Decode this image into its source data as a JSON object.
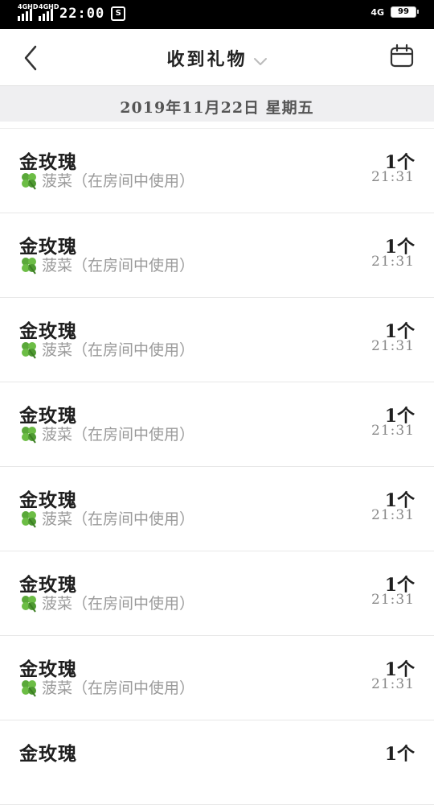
{
  "status_bar": {
    "network1": "4GHD",
    "network2": "4GHD",
    "time": "22:00",
    "right_network": "4G",
    "battery": "99"
  },
  "nav": {
    "title": "收到礼物"
  },
  "date_header": "2019年11月22日 星期五",
  "icons": {
    "back": "chevron-left-icon",
    "dropdown": "chevron-down-icon",
    "calendar": "calendar-icon",
    "clover": "four-leaf-clover-icon"
  },
  "colors": {
    "header_bg": "#efeff1",
    "clover_green": "#5aa83a"
  },
  "gifts": [
    {
      "name": "金玫瑰",
      "sender": "菠菜（在房间中使用）",
      "count": "1个",
      "time": "21:31"
    },
    {
      "name": "金玫瑰",
      "sender": "菠菜（在房间中使用）",
      "count": "1个",
      "time": "21:31"
    },
    {
      "name": "金玫瑰",
      "sender": "菠菜（在房间中使用）",
      "count": "1个",
      "time": "21:31"
    },
    {
      "name": "金玫瑰",
      "sender": "菠菜（在房间中使用）",
      "count": "1个",
      "time": "21:31"
    },
    {
      "name": "金玫瑰",
      "sender": "菠菜（在房间中使用）",
      "count": "1个",
      "time": "21:31"
    },
    {
      "name": "金玫瑰",
      "sender": "菠菜（在房间中使用）",
      "count": "1个",
      "time": "21:31"
    },
    {
      "name": "金玫瑰",
      "sender": "菠菜（在房间中使用）",
      "count": "1个",
      "time": "21:31"
    },
    {
      "name": "金玫瑰",
      "sender": "",
      "count": "1个",
      "time": ""
    }
  ]
}
